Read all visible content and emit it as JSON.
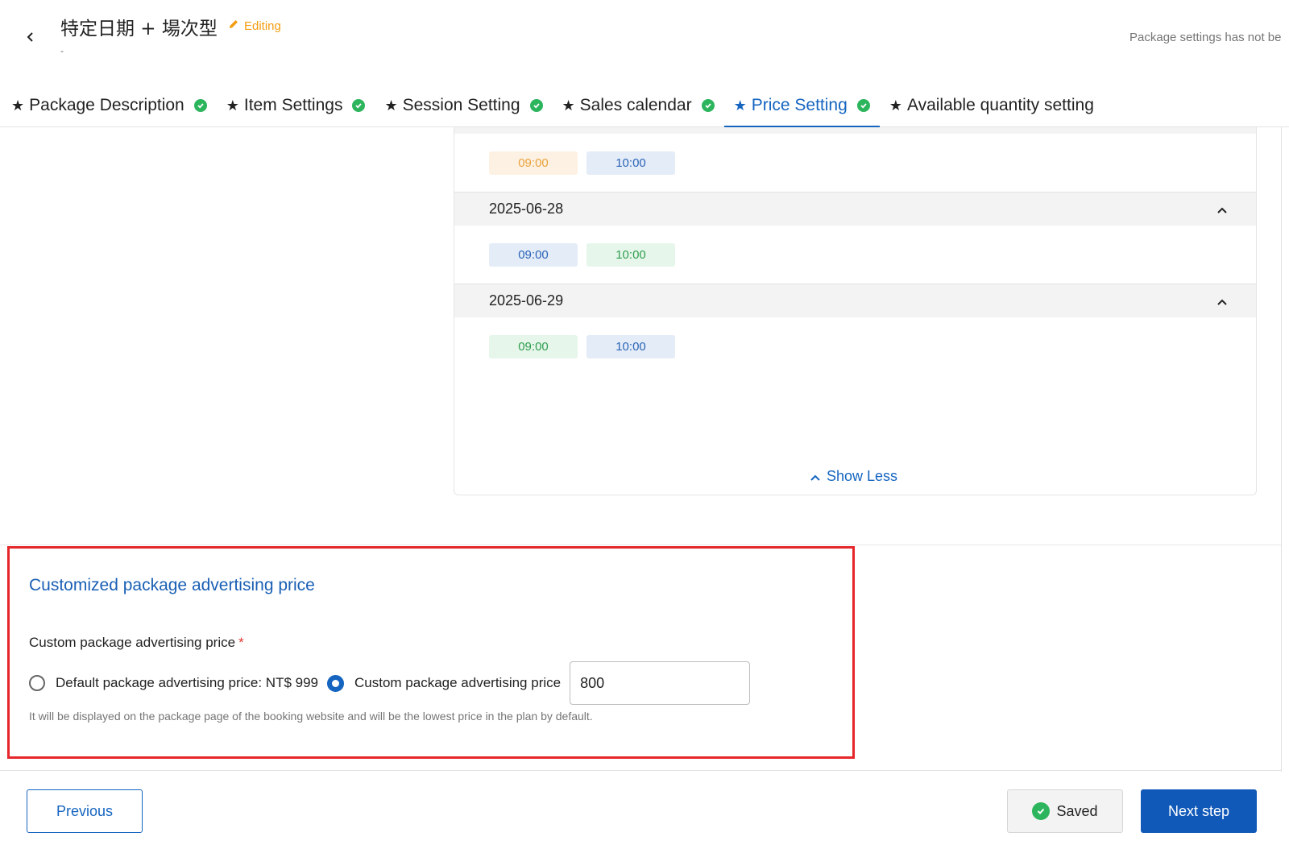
{
  "header": {
    "title": "特定日期 + 場次型",
    "editing_label": "Editing",
    "subtitle": "-",
    "unsaved_note": "Package settings has not be"
  },
  "tabs": [
    {
      "label": "Package Description",
      "completed": true,
      "active": false
    },
    {
      "label": "Item Settings",
      "completed": true,
      "active": false
    },
    {
      "label": "Session Setting",
      "completed": true,
      "active": false
    },
    {
      "label": "Sales calendar",
      "completed": true,
      "active": false
    },
    {
      "label": "Price Setting",
      "completed": true,
      "active": true
    },
    {
      "label": "Available quantity setting",
      "completed": false,
      "active": false
    }
  ],
  "sessions": {
    "first_times": [
      {
        "time": "09:00",
        "status": "orange"
      },
      {
        "time": "10:00",
        "status": "blue"
      }
    ],
    "dates": [
      {
        "date": "2025-06-28",
        "times": [
          {
            "time": "09:00",
            "status": "blue"
          },
          {
            "time": "10:00",
            "status": "green"
          }
        ]
      },
      {
        "date": "2025-06-29",
        "times": [
          {
            "time": "09:00",
            "status": "green"
          },
          {
            "time": "10:00",
            "status": "blue"
          }
        ]
      }
    ],
    "show_less_label": "Show Less"
  },
  "advertising": {
    "section_title": "Customized package advertising price",
    "field_label": "Custom package advertising price",
    "required_mark": "*",
    "option_default": "Default package advertising price: NT$ 999",
    "option_custom": "Custom package advertising price",
    "selected_option": "custom",
    "price_value": "800",
    "help_text": "It will be displayed on the package page of the booking website and will be the lowest price in the plan by default."
  },
  "footer": {
    "previous_label": "Previous",
    "saved_label": "Saved",
    "next_label": "Next step"
  },
  "colors": {
    "primary": "#1565c0",
    "success": "#2db55d",
    "editing": "#f39c12",
    "highlight_border": "#e5262a"
  }
}
